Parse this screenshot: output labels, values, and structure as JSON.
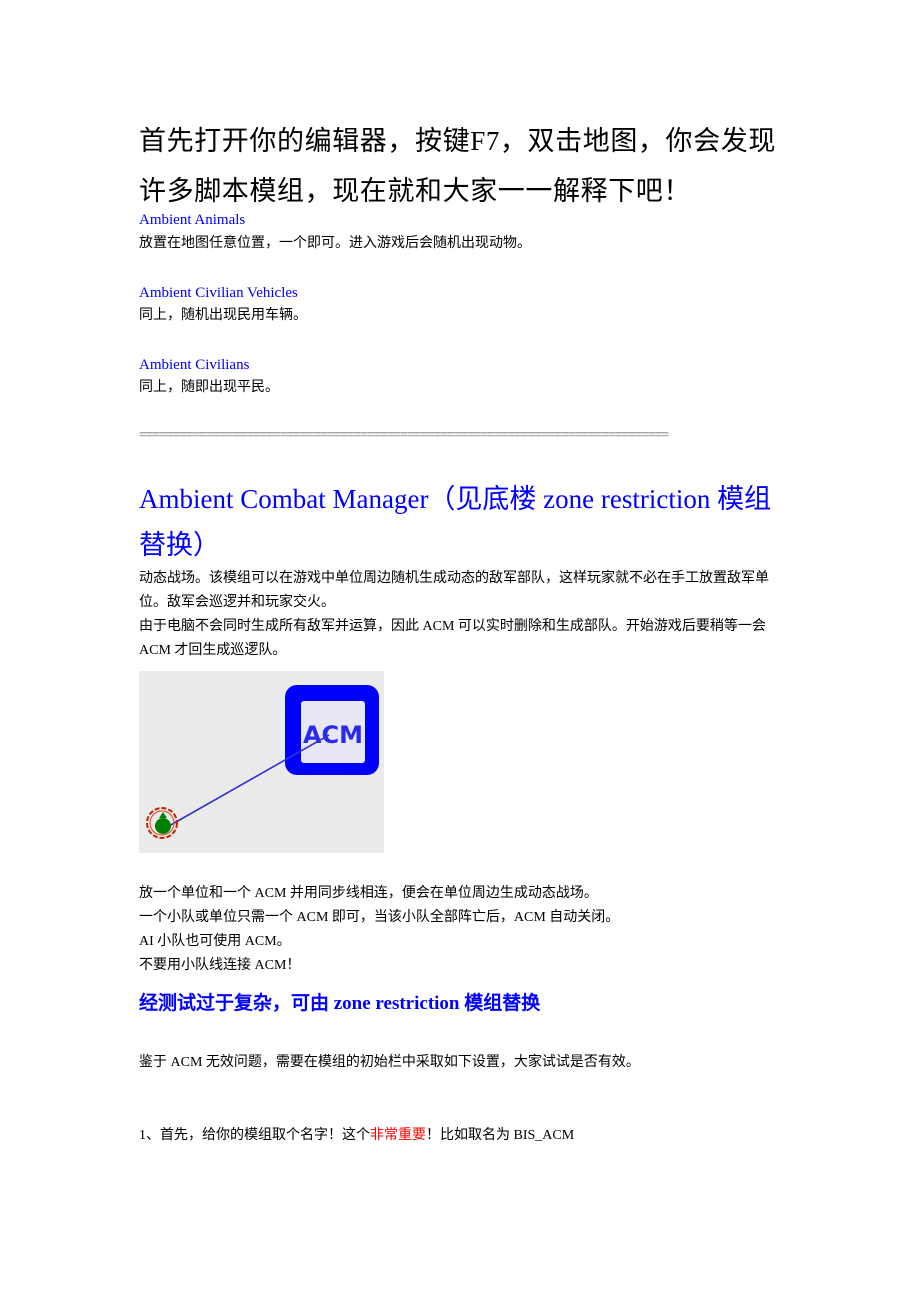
{
  "intro": {
    "title": "首先打开你的编辑器，按键F7，双击地图，你会发现许多脚本模组，现在就和大家一一解释下吧！"
  },
  "modules": [
    {
      "name": "Ambient Animals",
      "description": "放置在地图任意位置，一个即可。进入游戏后会随机出现动物。"
    },
    {
      "name": "Ambient Civilian Vehicles",
      "description": "同上，随机出现民用车辆。"
    },
    {
      "name": "Ambient Civilians",
      "description": "同上，随即出现平民。"
    }
  ],
  "separator": "===============================================================================",
  "acm": {
    "heading": "Ambient Combat Manager（见底楼 zone restriction 模组替换）",
    "paragraphs": [
      "动态战场。该模组可以在游戏中单位周边随机生成动态的敌军部队，这样玩家就不必在手工放置敌军单位。敌军会巡逻并和玩家交火。",
      "由于电脑不会同时生成所有敌军并运算，因此 ACM 可以实时删除和生成部队。开始游戏后要稍等一会 ACM 才回生成巡逻队。"
    ],
    "figure": {
      "icon_label": "ACM",
      "colors": {
        "module_box": "#0000ff",
        "sync_line": "#3333cc",
        "unit_marker": "#008000",
        "unit_ring": "#cc2200"
      }
    },
    "notes": [
      "放一个单位和一个 ACM 并用同步线相连，便会在单位周边生成动态战场。",
      "一个小队或单位只需一个 ACM 即可，当该小队全部阵亡后，ACM 自动关闭。",
      "AI 小队也可使用 ACM。",
      "不要用小队线连接 ACM！"
    ],
    "subheading": "经测试过于复杂，可由 zone restriction 模组替换",
    "advice": "鉴于 ACM 无效问题，需要在模组的初始栏中采取如下设置，大家试试是否有效。",
    "step1": {
      "prefix": "1、首先，给你的模组取个名字！这个",
      "emphasis": "非常重要",
      "suffix": "！比如取名为 BIS_ACM"
    }
  },
  "colors": {
    "link_blue": "#0000ff",
    "emphasis_red": "#ff0000",
    "text": "#000000"
  }
}
